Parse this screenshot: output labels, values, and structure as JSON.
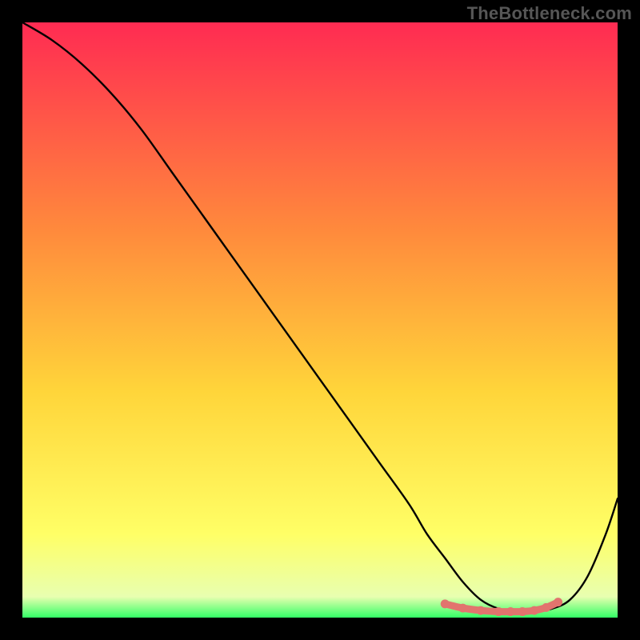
{
  "watermark": "TheBottleneck.com",
  "colors": {
    "bg": "#000000",
    "grad_top": "#ff2b52",
    "grad_mid1": "#ff8a3c",
    "grad_mid2": "#ffd53a",
    "grad_mid3": "#ffff66",
    "grad_bottom": "#33ff66",
    "curve": "#000000",
    "highlight": "#e2746e"
  },
  "chart_data": {
    "type": "line",
    "title": "",
    "xlabel": "",
    "ylabel": "",
    "xlim": [
      0,
      100
    ],
    "ylim": [
      0,
      100
    ],
    "grid": false,
    "series": [
      {
        "name": "bottleneck-curve",
        "x": [
          0,
          5,
          10,
          15,
          20,
          25,
          30,
          35,
          40,
          45,
          50,
          55,
          60,
          65,
          68,
          71,
          74,
          77,
          80,
          83,
          86,
          89,
          92,
          95,
          98,
          100
        ],
        "y": [
          100,
          97,
          93,
          88,
          82,
          75,
          68,
          61,
          54,
          47,
          40,
          33,
          26,
          19,
          14,
          10,
          6,
          3,
          1.5,
          1,
          1,
          1.5,
          3,
          7,
          14,
          20
        ]
      }
    ],
    "highlight_range": {
      "name": "bottleneck-flat-region",
      "x": [
        71,
        74,
        77,
        80,
        82,
        84,
        86,
        88,
        90
      ],
      "y": [
        2.3,
        1.6,
        1.2,
        1.0,
        1.0,
        1.0,
        1.2,
        1.7,
        2.6
      ]
    }
  }
}
